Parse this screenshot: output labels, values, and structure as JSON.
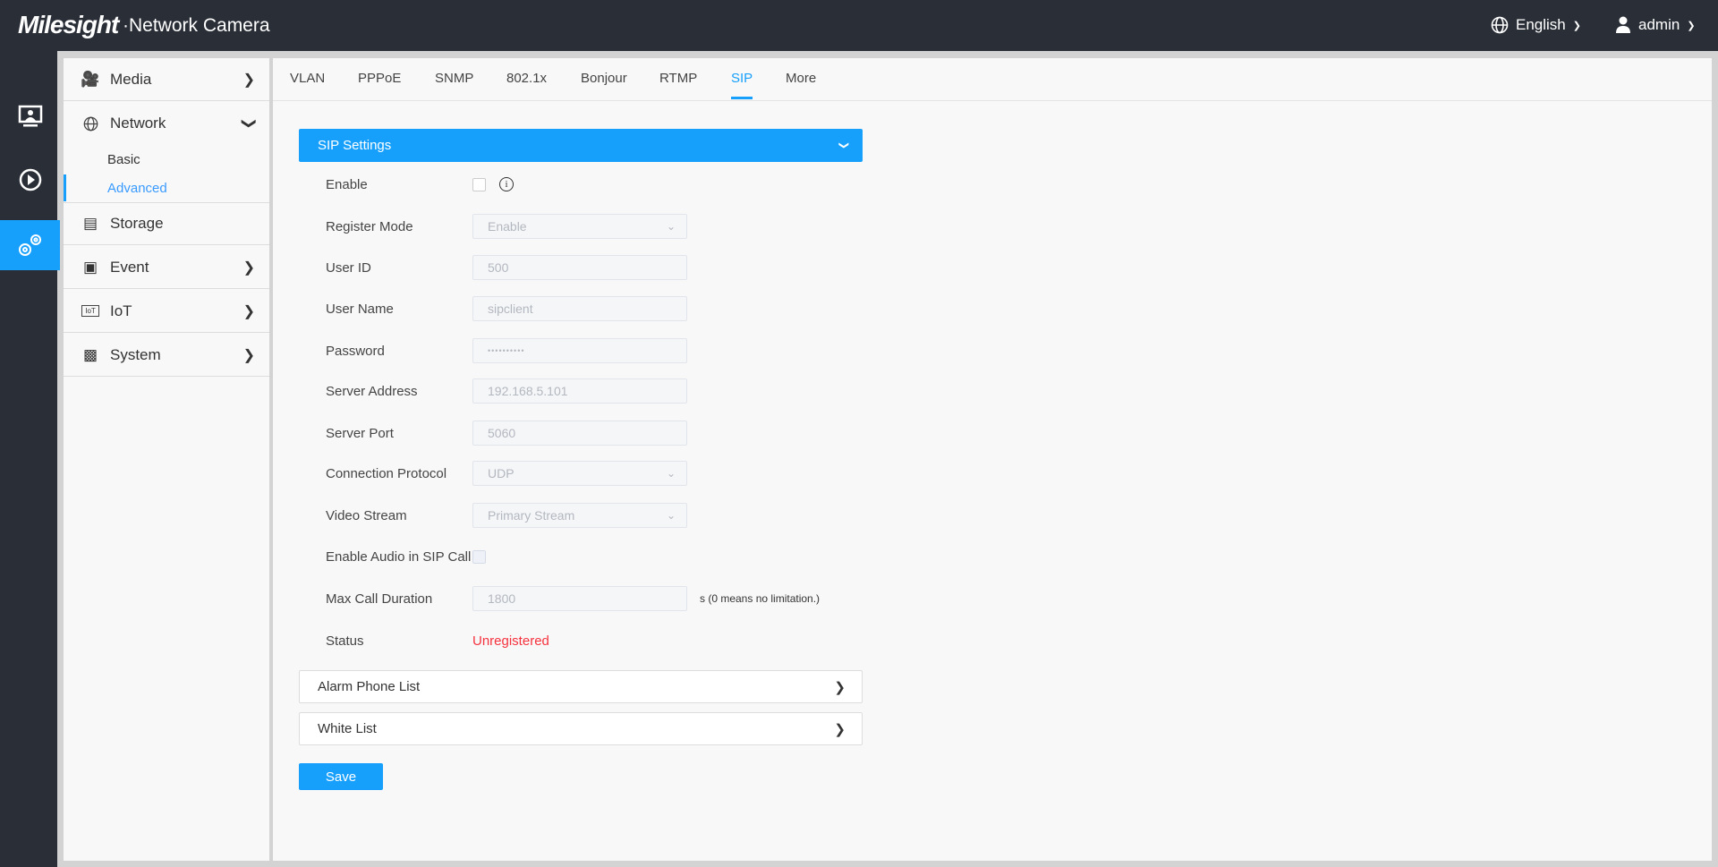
{
  "header": {
    "logo": "Milesight",
    "title": "·Network Camera",
    "language": "English",
    "user": "admin"
  },
  "rail": [
    {
      "icon": "live-view-icon"
    },
    {
      "icon": "playback-icon"
    },
    {
      "icon": "settings-icon",
      "active": true
    }
  ],
  "sidebar": {
    "media": "Media",
    "network": "Network",
    "basic": "Basic",
    "advanced": "Advanced",
    "storage": "Storage",
    "event": "Event",
    "iot": "IoT",
    "system": "System"
  },
  "tabs": [
    "VLAN",
    "PPPoE",
    "SNMP",
    "802.1x",
    "Bonjour",
    "RTMP",
    "SIP",
    "More"
  ],
  "active_tab": "SIP",
  "sip": {
    "title": "SIP Settings",
    "enable_label": "Enable",
    "register_mode_label": "Register Mode",
    "register_mode": "Enable",
    "user_id_label": "User ID",
    "user_id": "500",
    "user_name_label": "User Name",
    "user_name": "sipclient",
    "password_label": "Password",
    "password": "••••••••••",
    "server_address_label": "Server Address",
    "server_address": "192.168.5.101",
    "server_port_label": "Server Port",
    "server_port": "5060",
    "protocol_label": "Connection Protocol",
    "protocol": "UDP",
    "video_stream_label": "Video Stream",
    "video_stream": "Primary Stream",
    "audio_label": "Enable Audio in SIP Call",
    "max_call_label": "Max Call Duration",
    "max_call": "1800",
    "max_call_note": "s (0 means no limitation.)",
    "status_label": "Status",
    "status": "Unregistered"
  },
  "panels": {
    "alarm": "Alarm Phone List",
    "white": "White List"
  },
  "save": "Save",
  "colors": {
    "accent": "#17a0fb",
    "header": "#2a2e37",
    "error": "#f5333f"
  }
}
